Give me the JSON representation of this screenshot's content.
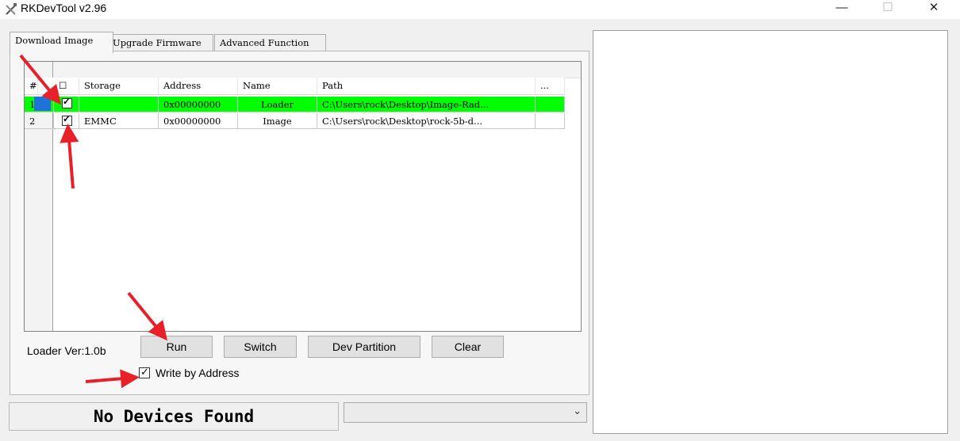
{
  "window": {
    "title": "RKDevTool v2.96",
    "minimize": "—",
    "maximize": "☐",
    "close": "✕"
  },
  "tabs": [
    "Download Image",
    "Upgrade Firmware",
    "Advanced Function"
  ],
  "table": {
    "headers": [
      "#",
      "☐",
      "Storage",
      "Address",
      "Name",
      "Path",
      "..."
    ],
    "rows": [
      {
        "num": "1",
        "checked": true,
        "storage": "",
        "address": "0x00000000",
        "name": "Loader",
        "path": "C:\\Users\\rock\\Desktop\\Image-Rad...",
        "selected": true
      },
      {
        "num": "2",
        "checked": true,
        "storage": "EMMC",
        "address": "0x00000000",
        "name": "Image",
        "path": "C:\\Users\\rock\\Desktop\\rock-5b-d...",
        "selected": false
      }
    ]
  },
  "loader_version": "Loader Ver:1.0b",
  "buttons": {
    "run": "Run",
    "switch": "Switch",
    "dev_partition": "Dev Partition",
    "clear": "Clear"
  },
  "write_by_address": {
    "label": "Write by Address",
    "checked": true
  },
  "status": "No Devices Found",
  "combo": {
    "value": ""
  },
  "colors": {
    "selected_row": "#00ff00",
    "annotation_arrow": "#e8202a"
  }
}
